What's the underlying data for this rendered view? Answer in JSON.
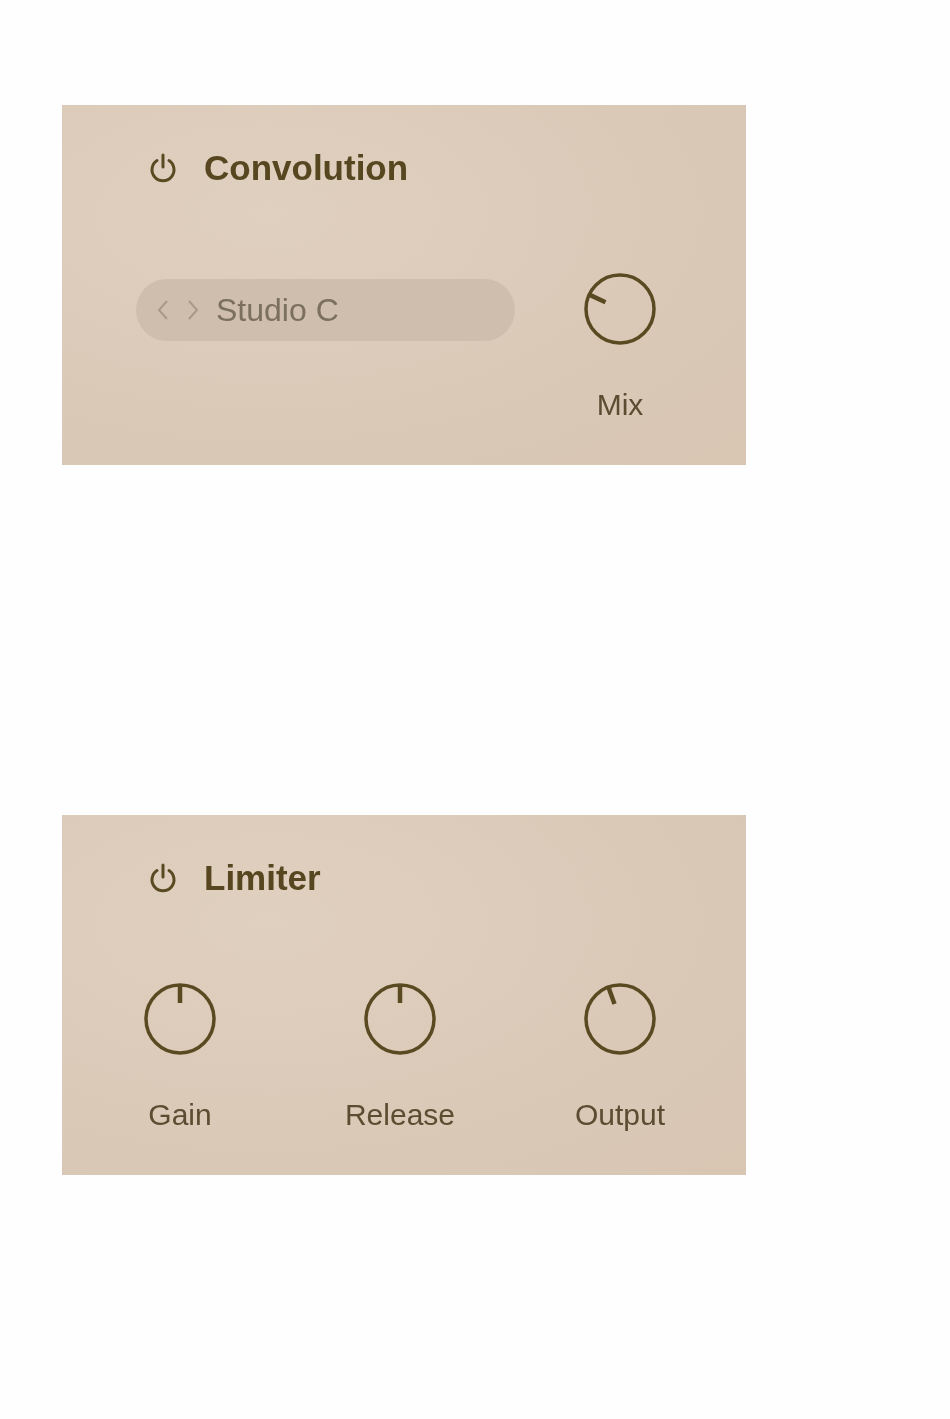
{
  "panels": [
    {
      "title": "Convolution",
      "kind": "preset",
      "preset": {
        "value": "Studio C"
      },
      "knobs": [
        {
          "label": "Mix"
        }
      ]
    },
    {
      "title": "Limiter",
      "kind": "knobs",
      "knobs": [
        {
          "label": "Gain"
        },
        {
          "label": "Release"
        },
        {
          "label": "Output"
        }
      ]
    }
  ]
}
